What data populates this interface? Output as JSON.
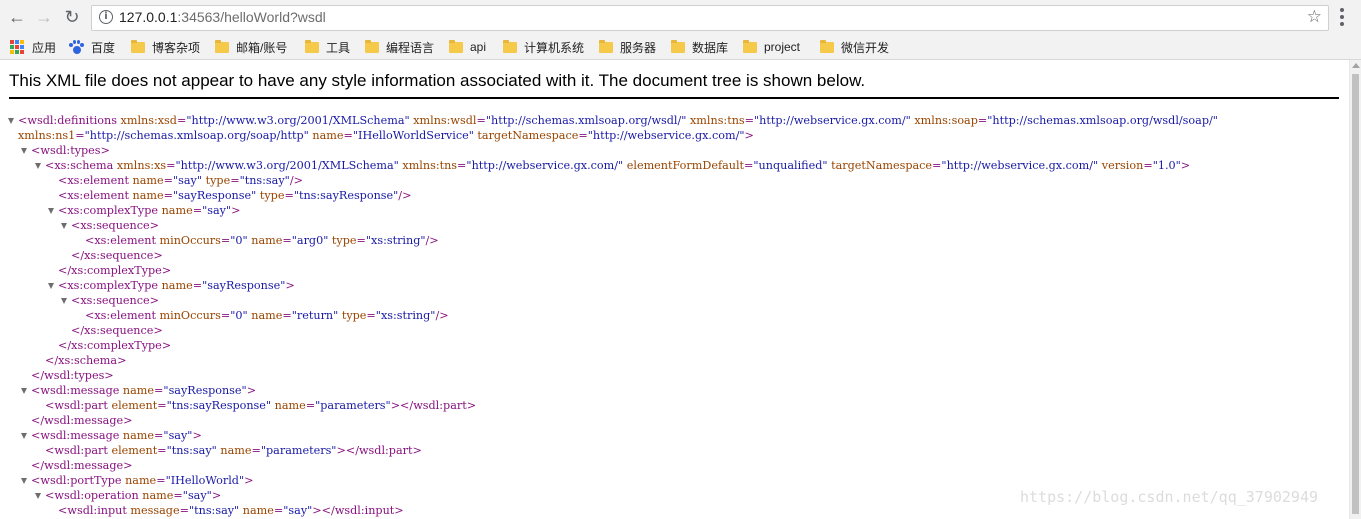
{
  "browser": {
    "url_host": "127.0.0.1",
    "url_rest": ":34563/helloWorld?wsdl"
  },
  "bookmarks": [
    {
      "label": "应用",
      "icon": "apps-grid-icon"
    },
    {
      "label": "百度",
      "icon": "baidu-paw-icon"
    },
    {
      "label": "博客杂项",
      "icon": "folder-icon"
    },
    {
      "label": "邮箱/账号",
      "icon": "folder-icon"
    },
    {
      "label": "工具",
      "icon": "folder-icon"
    },
    {
      "label": "编程语言",
      "icon": "folder-icon"
    },
    {
      "label": "api",
      "icon": "folder-icon"
    },
    {
      "label": "计算机系统",
      "icon": "folder-icon"
    },
    {
      "label": "服务器",
      "icon": "folder-icon"
    },
    {
      "label": "数据库",
      "icon": "folder-icon"
    },
    {
      "label": "project",
      "icon": "folder-icon"
    },
    {
      "label": "微信开发",
      "icon": "folder-icon"
    }
  ],
  "page": {
    "info_message": "This XML file does not appear to have any style information associated with it. The document tree is shown below."
  },
  "xml_lines": [
    [
      [
        "t",
        "<wsdl:definitions"
      ],
      [
        "a",
        " xmlns:xsd"
      ],
      [
        "t",
        "="
      ],
      [
        "v",
        "\"http://www.w3.org/2001/XMLSchema\""
      ],
      [
        "a",
        " xmlns:wsdl"
      ],
      [
        "t",
        "="
      ],
      [
        "v",
        "\"http://schemas.xmlsoap.org/wsdl/\""
      ],
      [
        "a",
        " xmlns:tns"
      ],
      [
        "t",
        "="
      ],
      [
        "v",
        "\"http://webservice.gx.com/\""
      ],
      [
        "a",
        " xmlns:soap"
      ],
      [
        "t",
        "="
      ],
      [
        "v",
        "\"http://schemas.xmlsoap.org/wsdl/soap/\""
      ]
    ],
    [
      [
        "a",
        "xmlns:ns1"
      ],
      [
        "t",
        "="
      ],
      [
        "v",
        "\"http://schemas.xmlsoap.org/soap/http\""
      ],
      [
        "a",
        " name"
      ],
      [
        "t",
        "="
      ],
      [
        "v",
        "\"IHelloWorldService\""
      ],
      [
        "a",
        " targetNamespace"
      ],
      [
        "t",
        "="
      ],
      [
        "v",
        "\"http://webservice.gx.com/\""
      ],
      [
        "t",
        ">"
      ]
    ],
    [
      [
        "t",
        "<wsdl:types>"
      ]
    ],
    [
      [
        "t",
        "<xs:schema"
      ],
      [
        "a",
        " xmlns:xs"
      ],
      [
        "t",
        "="
      ],
      [
        "v",
        "\"http://www.w3.org/2001/XMLSchema\""
      ],
      [
        "a",
        " xmlns:tns"
      ],
      [
        "t",
        "="
      ],
      [
        "v",
        "\"http://webservice.gx.com/\""
      ],
      [
        "a",
        " elementFormDefault"
      ],
      [
        "t",
        "="
      ],
      [
        "v",
        "\"unqualified\""
      ],
      [
        "a",
        " targetNamespace"
      ],
      [
        "t",
        "="
      ],
      [
        "v",
        "\"http://webservice.gx.com/\""
      ],
      [
        "a",
        " version"
      ],
      [
        "t",
        "="
      ],
      [
        "v",
        "\"1.0\""
      ],
      [
        "t",
        ">"
      ]
    ],
    [
      [
        "t",
        "<xs:element"
      ],
      [
        "a",
        " name"
      ],
      [
        "t",
        "="
      ],
      [
        "v",
        "\"say\""
      ],
      [
        "a",
        " type"
      ],
      [
        "t",
        "="
      ],
      [
        "v",
        "\"tns:say\""
      ],
      [
        "t",
        "/>"
      ]
    ],
    [
      [
        "t",
        "<xs:element"
      ],
      [
        "a",
        " name"
      ],
      [
        "t",
        "="
      ],
      [
        "v",
        "\"sayResponse\""
      ],
      [
        "a",
        " type"
      ],
      [
        "t",
        "="
      ],
      [
        "v",
        "\"tns:sayResponse\""
      ],
      [
        "t",
        "/>"
      ]
    ],
    [
      [
        "t",
        "<xs:complexType"
      ],
      [
        "a",
        " name"
      ],
      [
        "t",
        "="
      ],
      [
        "v",
        "\"say\""
      ],
      [
        "t",
        ">"
      ]
    ],
    [
      [
        "t",
        "<xs:sequence>"
      ]
    ],
    [
      [
        "t",
        "<xs:element"
      ],
      [
        "a",
        " minOccurs"
      ],
      [
        "t",
        "="
      ],
      [
        "v",
        "\"0\""
      ],
      [
        "a",
        " name"
      ],
      [
        "t",
        "="
      ],
      [
        "v",
        "\"arg0\""
      ],
      [
        "a",
        " type"
      ],
      [
        "t",
        "="
      ],
      [
        "v",
        "\"xs:string\""
      ],
      [
        "t",
        "/>"
      ]
    ],
    [
      [
        "t",
        "</xs:sequence>"
      ]
    ],
    [
      [
        "t",
        "</xs:complexType>"
      ]
    ],
    [
      [
        "t",
        "<xs:complexType"
      ],
      [
        "a",
        " name"
      ],
      [
        "t",
        "="
      ],
      [
        "v",
        "\"sayResponse\""
      ],
      [
        "t",
        ">"
      ]
    ],
    [
      [
        "t",
        "<xs:sequence>"
      ]
    ],
    [
      [
        "t",
        "<xs:element"
      ],
      [
        "a",
        " minOccurs"
      ],
      [
        "t",
        "="
      ],
      [
        "v",
        "\"0\""
      ],
      [
        "a",
        " name"
      ],
      [
        "t",
        "="
      ],
      [
        "v",
        "\"return\""
      ],
      [
        "a",
        " type"
      ],
      [
        "t",
        "="
      ],
      [
        "v",
        "\"xs:string\""
      ],
      [
        "t",
        "/>"
      ]
    ],
    [
      [
        "t",
        "</xs:sequence>"
      ]
    ],
    [
      [
        "t",
        "</xs:complexType>"
      ]
    ],
    [
      [
        "t",
        "</xs:schema>"
      ]
    ],
    [
      [
        "t",
        "</wsdl:types>"
      ]
    ],
    [
      [
        "t",
        "<wsdl:message"
      ],
      [
        "a",
        " name"
      ],
      [
        "t",
        "="
      ],
      [
        "v",
        "\"sayResponse\""
      ],
      [
        "t",
        ">"
      ]
    ],
    [
      [
        "t",
        "<wsdl:part"
      ],
      [
        "a",
        " element"
      ],
      [
        "t",
        "="
      ],
      [
        "v",
        "\"tns:sayResponse\""
      ],
      [
        "a",
        " name"
      ],
      [
        "t",
        "="
      ],
      [
        "v",
        "\"parameters\""
      ],
      [
        "t",
        "></wsdl:part>"
      ]
    ],
    [
      [
        "t",
        "</wsdl:message>"
      ]
    ],
    [
      [
        "t",
        "<wsdl:message"
      ],
      [
        "a",
        " name"
      ],
      [
        "t",
        "="
      ],
      [
        "v",
        "\"say\""
      ],
      [
        "t",
        ">"
      ]
    ],
    [
      [
        "t",
        "<wsdl:part"
      ],
      [
        "a",
        " element"
      ],
      [
        "t",
        "="
      ],
      [
        "v",
        "\"tns:say\""
      ],
      [
        "a",
        " name"
      ],
      [
        "t",
        "="
      ],
      [
        "v",
        "\"parameters\""
      ],
      [
        "t",
        "></wsdl:part>"
      ]
    ],
    [
      [
        "t",
        "</wsdl:message>"
      ]
    ],
    [
      [
        "t",
        "<wsdl:portType"
      ],
      [
        "a",
        " name"
      ],
      [
        "t",
        "="
      ],
      [
        "v",
        "\"IHelloWorld\""
      ],
      [
        "t",
        ">"
      ]
    ],
    [
      [
        "t",
        "<wsdl:operation"
      ],
      [
        "a",
        " name"
      ],
      [
        "t",
        "="
      ],
      [
        "v",
        "\"say\""
      ],
      [
        "t",
        ">"
      ]
    ],
    [
      [
        "t",
        "<wsdl:input"
      ],
      [
        "a",
        " message"
      ],
      [
        "t",
        "="
      ],
      [
        "v",
        "\"tns:say\""
      ],
      [
        "a",
        " name"
      ],
      [
        "t",
        "="
      ],
      [
        "v",
        "\"say\""
      ],
      [
        "t",
        "></wsdl:input>"
      ]
    ]
  ],
  "watermark": "https://blog.csdn.net/qq_37902949"
}
